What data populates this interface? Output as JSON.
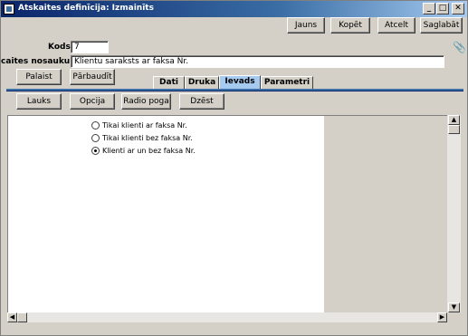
{
  "window": {
    "title": "Atskaites definīcija: Izmainīts",
    "minimize_glyph": "_",
    "maximize_glyph": "□",
    "close_glyph": "✕"
  },
  "toolbar": {
    "new_label": "Jauns",
    "copy_label": "Kopēt",
    "cancel_label": "Atcelt",
    "save_label": "Saglabāt"
  },
  "form": {
    "code_label": "Kods:",
    "code_value": "7",
    "name_label": "caites nosaukums:",
    "name_value": "Klientu saraksts ar faksa Nr."
  },
  "actions": {
    "run_label": "Palaist",
    "check_label": "Pārbaudīt"
  },
  "tabs": [
    {
      "label": "Dati",
      "active": false
    },
    {
      "label": "Druka",
      "active": false
    },
    {
      "label": "Ievads",
      "active": true
    },
    {
      "label": "Parametri",
      "active": false
    }
  ],
  "input_toolbar": {
    "field_label": "Lauks",
    "option_label": "Opcija",
    "radio_label": "Radio poga",
    "delete_label": "Dzēst"
  },
  "radio_options": [
    {
      "label": "Tikai klienti ar faksa Nr.",
      "checked": false
    },
    {
      "label": "Tikai klienti bez faksa Nr.",
      "checked": false
    },
    {
      "label": "Klienti ar un bez faksa Nr.",
      "checked": true
    }
  ],
  "icons": {
    "attachment": "paperclip-icon",
    "app": "window-app-icon"
  },
  "colors": {
    "titlebar_start": "#0a246a",
    "active_tab": "#a6caf0",
    "separator": "#3a6ea5"
  }
}
